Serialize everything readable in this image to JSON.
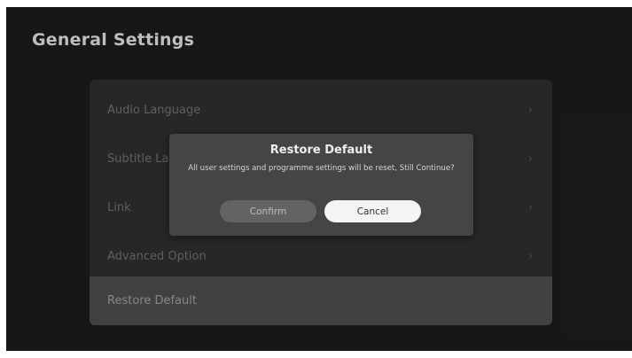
{
  "page": {
    "title": "General Settings"
  },
  "menu": {
    "items": [
      {
        "label": "Audio Language",
        "chevron": "›"
      },
      {
        "label": "Subtitle Language",
        "chevron": "›"
      },
      {
        "label": "Link",
        "chevron": "›"
      },
      {
        "label": "Advanced Option",
        "chevron": "›"
      },
      {
        "label": "Restore Default",
        "chevron": ""
      }
    ],
    "selected_index": 4
  },
  "dialog": {
    "title": "Restore Default",
    "message": "All user settings and programme settings will be reset, Still Continue?",
    "confirm_label": "Confirm",
    "cancel_label": "Cancel",
    "focused": "Cancel"
  },
  "colors": {
    "background": "#1b1b1b",
    "panel": "#2d2d2d",
    "dialog": "#454545",
    "focused_button": "#f4f4f4"
  }
}
